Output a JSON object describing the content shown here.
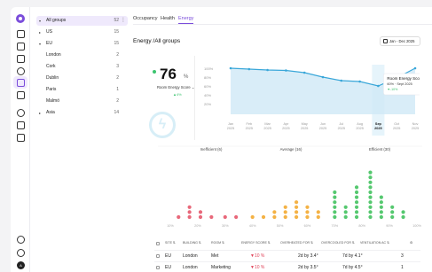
{
  "tree": {
    "items": [
      {
        "label": "All groups",
        "count": "52",
        "chevron": "▾"
      },
      {
        "label": "US",
        "count": "15",
        "chevron": "▸"
      },
      {
        "label": "EU",
        "count": "15",
        "chevron": "▾"
      },
      {
        "label": "London",
        "count": "2",
        "chevron": ""
      },
      {
        "label": "Cork",
        "count": "3",
        "chevron": ""
      },
      {
        "label": "Dublin",
        "count": "2",
        "chevron": ""
      },
      {
        "label": "Paris",
        "count": "1",
        "chevron": ""
      },
      {
        "label": "Malmö",
        "count": "2",
        "chevron": ""
      },
      {
        "label": "Asia",
        "count": "14",
        "chevron": "▸"
      }
    ],
    "kebab": "⋮"
  },
  "tabs": [
    "Occupancy",
    "Health",
    "Energy"
  ],
  "header": {
    "title": "Energy /All groups",
    "date_range": "Jan - Dec 2025"
  },
  "score": {
    "value": "76",
    "unit": "%",
    "label": "Room Energy Score ⌄",
    "change": "▲4%"
  },
  "tooltip": {
    "title": "Room Energy Score",
    "value": "60% · Sept 2025",
    "change": "▼-10%"
  },
  "avatar": "A",
  "chart_data": [
    {
      "type": "area",
      "title": "",
      "categories": [
        "Jan 2025",
        "Feb 2025",
        "Mar 2025",
        "Apr 2025",
        "May 2025",
        "Jun 2025",
        "Jul 2025",
        "Aug 2025",
        "Sep 2025",
        "Oct 2025",
        "Nov 2025"
      ],
      "category_labels_top": [
        "Jan",
        "Feb",
        "Mar",
        "Apr",
        "May",
        "Jun",
        "Jul",
        "Aug",
        "Sep",
        "Oct",
        "Nov"
      ],
      "category_labels_bottom": [
        "2025",
        "2025",
        "2025",
        "2025",
        "2025",
        "2025",
        "2025",
        "2025",
        "2025",
        "2025",
        "2025"
      ],
      "series": [
        {
          "values": [
            100,
            98,
            96,
            95,
            90,
            80,
            72,
            70,
            60,
            78,
            100
          ]
        }
      ],
      "yticks": [
        "100%",
        "80%",
        "60%",
        "40%",
        "20%"
      ],
      "ylim": [
        0,
        100
      ],
      "highlight": "Sep 2025",
      "color": "#3aa7d9"
    },
    {
      "type": "scatter",
      "groups": [
        {
          "label": "Inefficient (6)",
          "color": "#e8687a"
        },
        {
          "label": "Average (16)",
          "color": "#f4b245"
        },
        {
          "label": "Efficient (30)",
          "color": "#55c86f"
        }
      ],
      "xticks": [
        "10%",
        "20%",
        "30%",
        "40%",
        "50%",
        "60%",
        "70%",
        "80%",
        "90%",
        "100%"
      ],
      "columns": [
        {
          "x": 13,
          "n": 1,
          "g": 0
        },
        {
          "x": 17,
          "n": 3,
          "g": 0
        },
        {
          "x": 21,
          "n": 2,
          "g": 0
        },
        {
          "x": 25,
          "n": 1,
          "g": 0
        },
        {
          "x": 30,
          "n": 1,
          "g": 0
        },
        {
          "x": 34,
          "n": 1,
          "g": 0
        },
        {
          "x": 40,
          "n": 1,
          "g": 1
        },
        {
          "x": 44,
          "n": 1,
          "g": 1
        },
        {
          "x": 48,
          "n": 2,
          "g": 1
        },
        {
          "x": 52,
          "n": 3,
          "g": 1
        },
        {
          "x": 56,
          "n": 4,
          "g": 1
        },
        {
          "x": 60,
          "n": 3,
          "g": 1
        },
        {
          "x": 64,
          "n": 2,
          "g": 1
        },
        {
          "x": 70,
          "n": 6,
          "g": 2
        },
        {
          "x": 74,
          "n": 3,
          "g": 2
        },
        {
          "x": 78,
          "n": 7,
          "g": 2
        },
        {
          "x": 83,
          "n": 10,
          "g": 2
        },
        {
          "x": 87,
          "n": 5,
          "g": 2
        },
        {
          "x": 91,
          "n": 3,
          "g": 2
        },
        {
          "x": 95,
          "n": 2,
          "g": 2
        }
      ]
    }
  ],
  "table": {
    "headers": [
      "SITE ⇅",
      "BUILDING ⇅",
      "ROOM ⇅",
      "ENERGY SCORE ⇅",
      "OVERHEATED FOR ⇅",
      "OVERCOOLED FOR ⇅",
      "VENTILATION AC ⇅",
      "⚙"
    ],
    "rows": [
      {
        "site": "EU",
        "building": "London",
        "room": "Met",
        "score": "▼10 %",
        "over": "2d by 3.4°",
        "cool": "7d by 4.1°",
        "vent": "3"
      },
      {
        "site": "EU",
        "building": "London",
        "room": "Marketing",
        "score": "▼10 %",
        "over": "2d by 3.5°",
        "cool": "7d by 4.5°",
        "vent": "1"
      }
    ]
  }
}
